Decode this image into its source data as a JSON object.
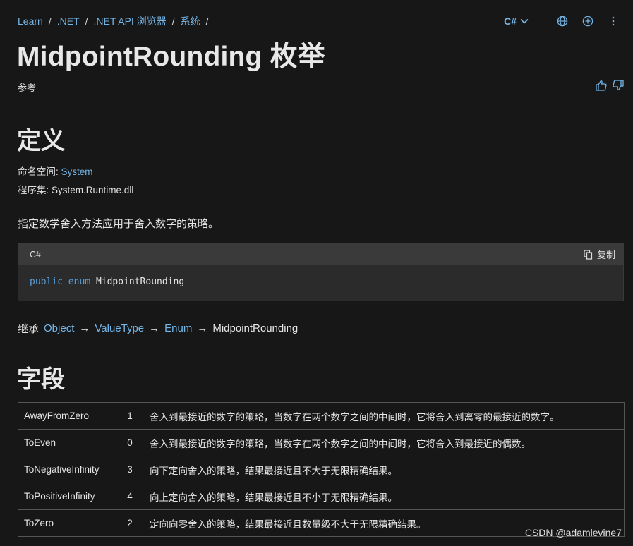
{
  "breadcrumb": [
    "Learn",
    ".NET",
    ".NET API 浏览器",
    "系统"
  ],
  "breadcrumb_sep": "/",
  "language": "C#",
  "icons": [
    "chevron-down-icon",
    "globe-icon",
    "add-circle-icon",
    "more-vertical-icon",
    "thumbs-up-icon",
    "thumbs-down-icon",
    "copy-icon"
  ],
  "page_title": "MidpointRounding 枚举",
  "reference_label": "参考",
  "definition": {
    "heading": "定义",
    "namespace_label": "命名空间:",
    "namespace_value": "System",
    "assembly_label": "程序集:",
    "assembly_value": "System.Runtime.dll",
    "summary": "指定数学舍入方法应用于舍入数字的策略。"
  },
  "code": {
    "language": "C#",
    "copy_label": "复制",
    "kw1": "public",
    "kw2": "enum",
    "name": "MidpointRounding"
  },
  "inheritance": {
    "label": "继承",
    "chain": [
      "Object",
      "ValueType",
      "Enum"
    ],
    "arrow": "→",
    "current": "MidpointRounding"
  },
  "fields": {
    "heading": "字段",
    "rows": [
      {
        "name": "AwayFromZero",
        "value": "1",
        "desc": "舍入到最接近的数字的策略，当数字在两个数字之间的中间时，它将舍入到离零的最接近的数字。"
      },
      {
        "name": "ToEven",
        "value": "0",
        "desc": "舍入到最接近的数字的策略，当数字在两个数字之间的中间时，它将舍入到最接近的偶数。"
      },
      {
        "name": "ToNegativeInfinity",
        "value": "3",
        "desc": "向下定向舍入的策略，结果最接近且不大于无限精确结果。"
      },
      {
        "name": "ToPositiveInfinity",
        "value": "4",
        "desc": "向上定向舍入的策略，结果最接近且不小于无限精确结果。"
      },
      {
        "name": "ToZero",
        "value": "2",
        "desc": "定向向零舍入的策略，结果最接近且数量级不大于无限精确结果。"
      }
    ]
  },
  "watermark": "CSDN @adamlevine7",
  "colors": {
    "background": "#171717",
    "link": "#75b6e7",
    "keyword": "#569cd6",
    "code_bg": "#2b2b2b",
    "code_header": "#3a3a3a"
  }
}
